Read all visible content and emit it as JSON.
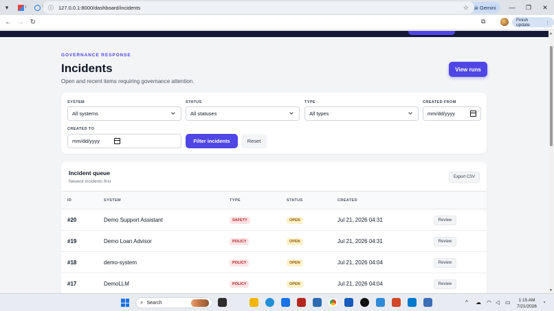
{
  "browser": {
    "url": "127.0.0.1:8000/dashboard/incidents",
    "ask_gemini_label": "Ask Gemini",
    "finish_update_label": "Finish update"
  },
  "page": {
    "eyebrow": "GOVERNANCE RESPONSE",
    "title": "Incidents",
    "subtitle": "Open and recent items requiring governance attention.",
    "view_runs_label": "View runs"
  },
  "filters": {
    "system_label": "SYSTEM",
    "system_value": "All systems",
    "status_label": "STATUS",
    "status_value": "All statuses",
    "type_label": "TYPE",
    "type_value": "All types",
    "created_from_label": "CREATED FROM",
    "created_from_value": "mm/dd/yyyy",
    "created_to_label": "CREATED TO",
    "created_to_value": "mm/dd/yyyy",
    "filter_button": "Filter incidents",
    "reset_button": "Reset"
  },
  "queue": {
    "title": "Incident queue",
    "subtitle": "Newest incidents first",
    "export_label": "Export CSV",
    "columns": [
      "ID",
      "SYSTEM",
      "TYPE",
      "STATUS",
      "CREATED"
    ],
    "review_label": "Review",
    "rows": [
      {
        "id": "#20",
        "system": "Demo Support Assistant",
        "type": "SAFETY",
        "status": "OPEN",
        "created": "Jul 21, 2026 04:31"
      },
      {
        "id": "#19",
        "system": "Demo Loan Advisor",
        "type": "POLICY",
        "status": "OPEN",
        "created": "Jul 21, 2026 04:31"
      },
      {
        "id": "#18",
        "system": "demo-system",
        "type": "POLICY",
        "status": "OPEN",
        "created": "Jul 21, 2026 04:04"
      },
      {
        "id": "#17",
        "system": "DemoLLM",
        "type": "POLICY",
        "status": "OPEN",
        "created": "Jul 21, 2026 04:04"
      }
    ]
  },
  "taskbar": {
    "search_label": "Search",
    "time": "1:15 AM",
    "date": "7/21/2026"
  }
}
